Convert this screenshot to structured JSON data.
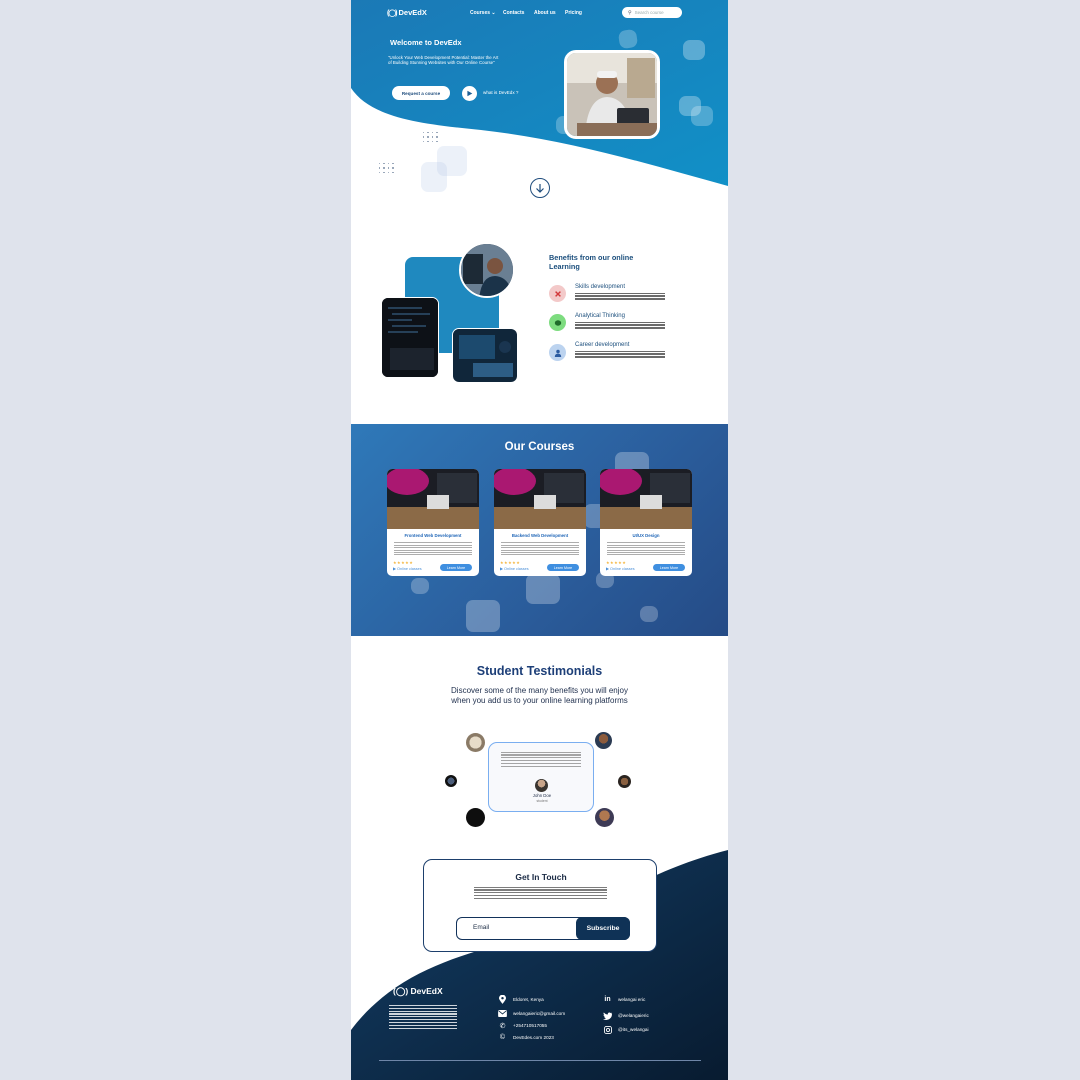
{
  "brand": {
    "name": "DevEdX",
    "footer_name": "DevEdX"
  },
  "nav": {
    "items": [
      "Courses",
      "Contacts",
      "About us",
      "Pricing"
    ],
    "search_placeholder": "Search course"
  },
  "hero": {
    "title": "Welcome to DevEdx",
    "subtitle": "\"Unlock Your Web Development Potential: Master the Art of Building Stunning Websites with Our Online Course\"",
    "request_button": "Request a course",
    "video_link": "what is DevEdx ?"
  },
  "benefits": {
    "title": "Benefits from our online Learning",
    "items": [
      {
        "label": "Skills development",
        "icon": "tools-icon",
        "color": "#f3c9c9"
      },
      {
        "label": "Analytical Thinking",
        "icon": "brain-icon",
        "color": "#7ddc7f"
      },
      {
        "label": "Career development",
        "icon": "person-icon",
        "color": "#bcd3ef"
      }
    ]
  },
  "courses": {
    "title": "Our Courses",
    "learn_label": "Learn More",
    "mode_label": "Online classes",
    "rating": "★★★★★",
    "items": [
      {
        "title": "Frontend Web Development"
      },
      {
        "title": "Backend Web Development"
      },
      {
        "title": "UI/UX Design"
      }
    ]
  },
  "testimonials": {
    "title": "Student Testimonials",
    "subtitle_line1": "Discover some of the many benefits you will enjoy",
    "subtitle_line2": "when you add us to your online learning platforms",
    "name": "John Doe",
    "role": "student"
  },
  "contact": {
    "title": "Get In Touch",
    "email_placeholder": "Email",
    "subscribe": "Subscribe"
  },
  "footer": {
    "location": "Eldoret, Kenya",
    "email": "welangaieric@gmail.com",
    "phone": "+254710517055",
    "copyright": "DevEdes.com 2023",
    "linkedin": "welangai eric",
    "twitter": "@welangaieric",
    "instagram": "@its_welangai"
  },
  "colors": {
    "primary": "#1f86c4",
    "navy": "#0f3256",
    "accent": "#3f8fe0"
  }
}
